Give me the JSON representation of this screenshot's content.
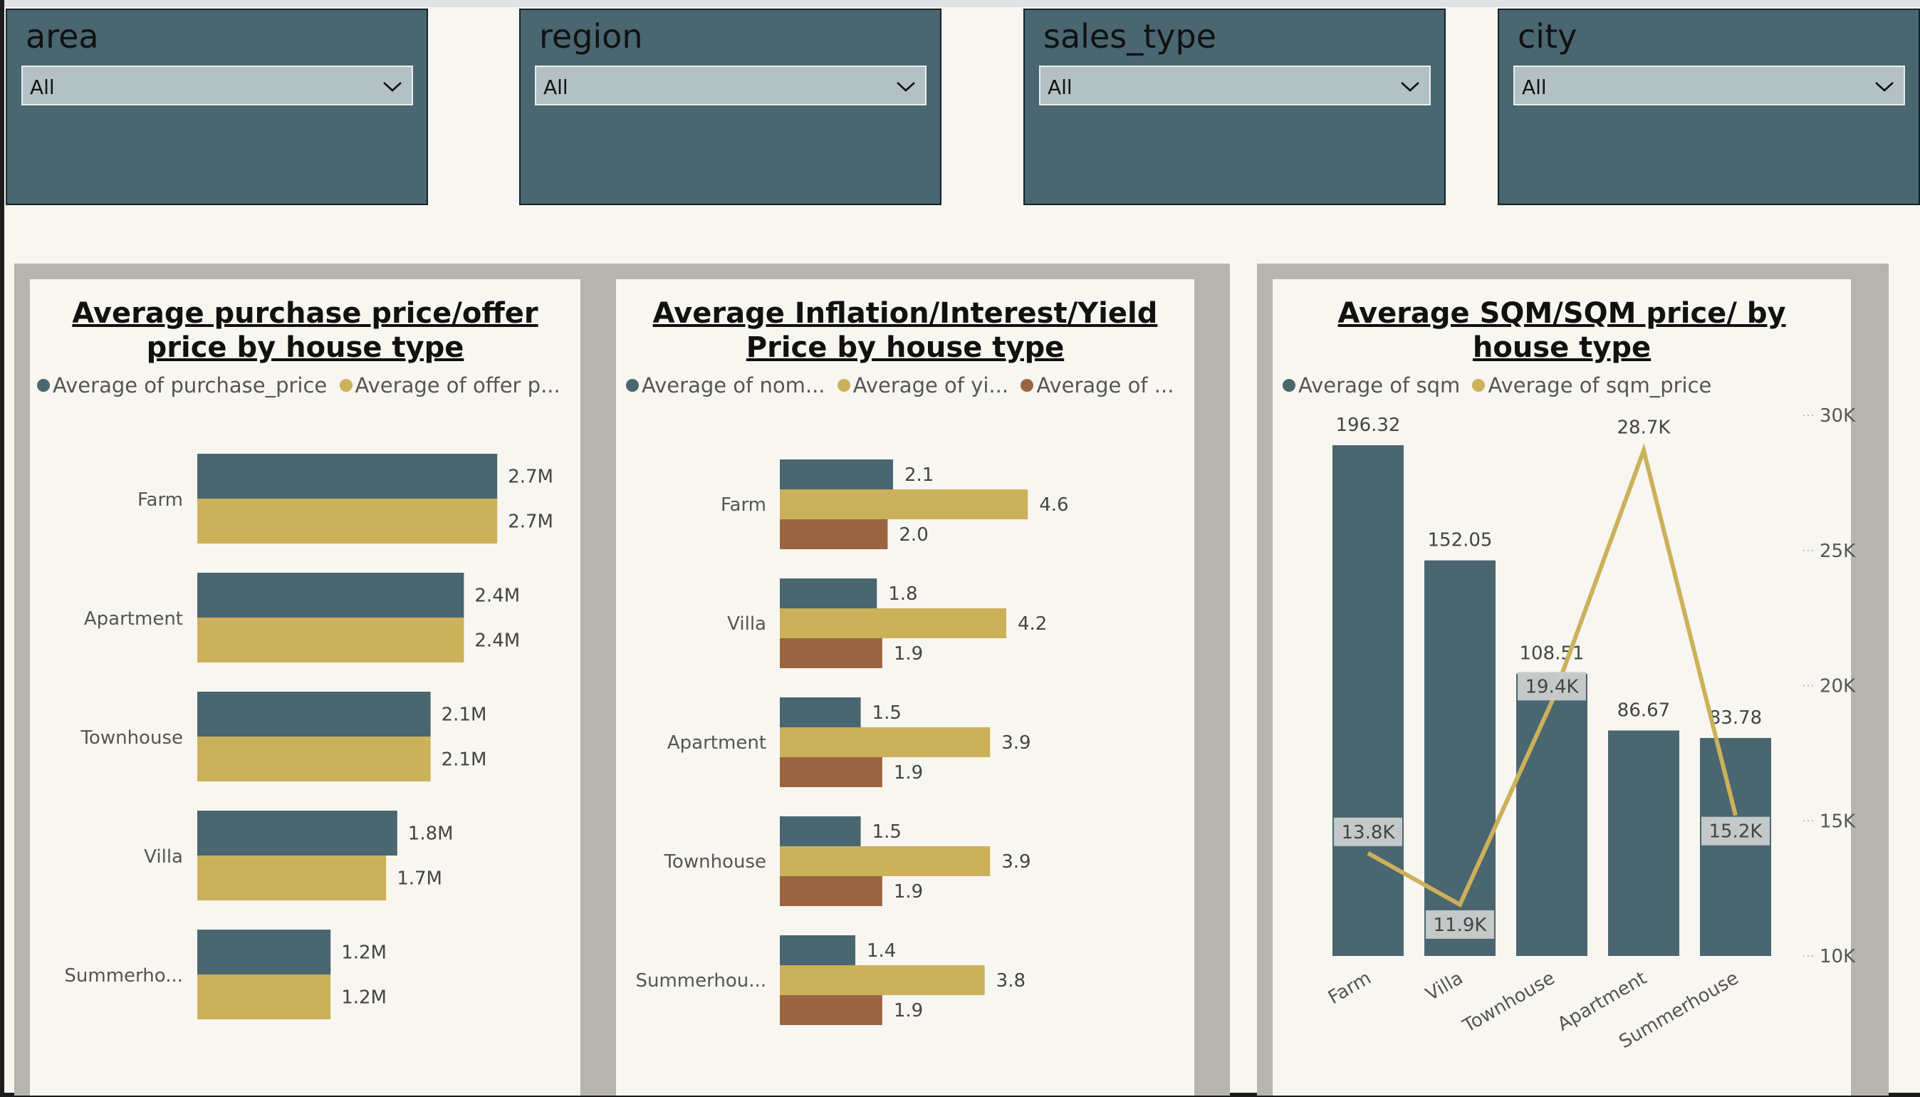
{
  "filters": [
    {
      "label": "area",
      "value": "All"
    },
    {
      "label": "region",
      "value": "All"
    },
    {
      "label": "sales_type",
      "value": "All"
    },
    {
      "label": "city",
      "value": "All"
    }
  ],
  "colors": {
    "dark": "#4a6670",
    "gold": "#cbb15a",
    "brown": "#9a6442"
  },
  "charts": {
    "purchase": {
      "title": "Average purchase price/offer price by house type",
      "legend": [
        "Average of purchase_price",
        "Average of offer p..."
      ]
    },
    "inflation": {
      "title": "Average Inflation/Interest/Yield Price by house type",
      "legend": [
        "Average of nom...",
        "Average of yi...",
        "Average of ..."
      ]
    },
    "sqm": {
      "title": "Average SQM/SQM price/ by house type",
      "legend": [
        "Average of sqm",
        "Average of sqm_price"
      ]
    }
  },
  "chart_data": [
    {
      "type": "bar",
      "orientation": "horizontal",
      "title": "Average purchase price/offer price by house type",
      "categories": [
        "Farm",
        "Apartment",
        "Townhouse",
        "Villa",
        "Summerho..."
      ],
      "series": [
        {
          "name": "Average of purchase_price",
          "values": [
            2.7,
            2.4,
            2.1,
            1.8,
            1.2
          ],
          "labels": [
            "2.7M",
            "2.4M",
            "2.1M",
            "1.8M",
            "1.2M"
          ]
        },
        {
          "name": "Average of offer p...",
          "values": [
            2.7,
            2.4,
            2.1,
            1.7,
            1.2
          ],
          "labels": [
            "2.7M",
            "2.4M",
            "2.1M",
            "1.7M",
            "1.2M"
          ]
        }
      ],
      "xlim": [
        0,
        3.0
      ],
      "unit": "M",
      "legend_position": "top-left"
    },
    {
      "type": "bar",
      "orientation": "horizontal",
      "title": "Average Inflation/Interest/Yield Price by house type",
      "categories": [
        "Farm",
        "Villa",
        "Apartment",
        "Townhouse",
        "Summerhou..."
      ],
      "series": [
        {
          "name": "Average of nom...",
          "values": [
            2.1,
            1.8,
            1.5,
            1.5,
            1.4
          ],
          "labels": [
            "2.1",
            "1.8",
            "1.5",
            "1.5",
            "1.4"
          ]
        },
        {
          "name": "Average of yi...",
          "values": [
            4.6,
            4.2,
            3.9,
            3.9,
            3.8
          ],
          "labels": [
            "4.6",
            "4.2",
            "3.9",
            "3.9",
            "3.8"
          ]
        },
        {
          "name": "Average of ...",
          "values": [
            2.0,
            1.9,
            1.9,
            1.9,
            1.9
          ],
          "labels": [
            "2.0",
            "1.9",
            "1.9",
            "1.9",
            "1.9"
          ]
        }
      ],
      "xlim": [
        0,
        7.2
      ],
      "legend_position": "top-left"
    },
    {
      "type": "bar",
      "combo": "bar-line",
      "title": "Average SQM/SQM price/ by house type",
      "categories": [
        "Farm",
        "Villa",
        "Townhouse",
        "Apartment",
        "Summerhouse"
      ],
      "series": [
        {
          "name": "Average of sqm",
          "type": "bar",
          "axis": "left",
          "values": [
            196.32,
            152.05,
            108.51,
            86.67,
            83.78
          ],
          "labels": [
            "196.32",
            "152.05",
            "108.51",
            "86.67",
            "83.78"
          ]
        },
        {
          "name": "Average of sqm_price",
          "type": "line",
          "axis": "right",
          "values": [
            13.8,
            11.9,
            19.4,
            28.7,
            15.2
          ],
          "labels": [
            "13.8K",
            "11.9K",
            "19.4K",
            "28.7K",
            "15.2K"
          ]
        }
      ],
      "ylim_left": [
        0,
        196.32
      ],
      "ylim_right": [
        10,
        30
      ],
      "right_ticks": [
        "10K",
        "15K",
        "20K",
        "25K",
        "30K"
      ],
      "right_tick_values": [
        10,
        15,
        20,
        25,
        30
      ],
      "legend_position": "top-left"
    }
  ]
}
